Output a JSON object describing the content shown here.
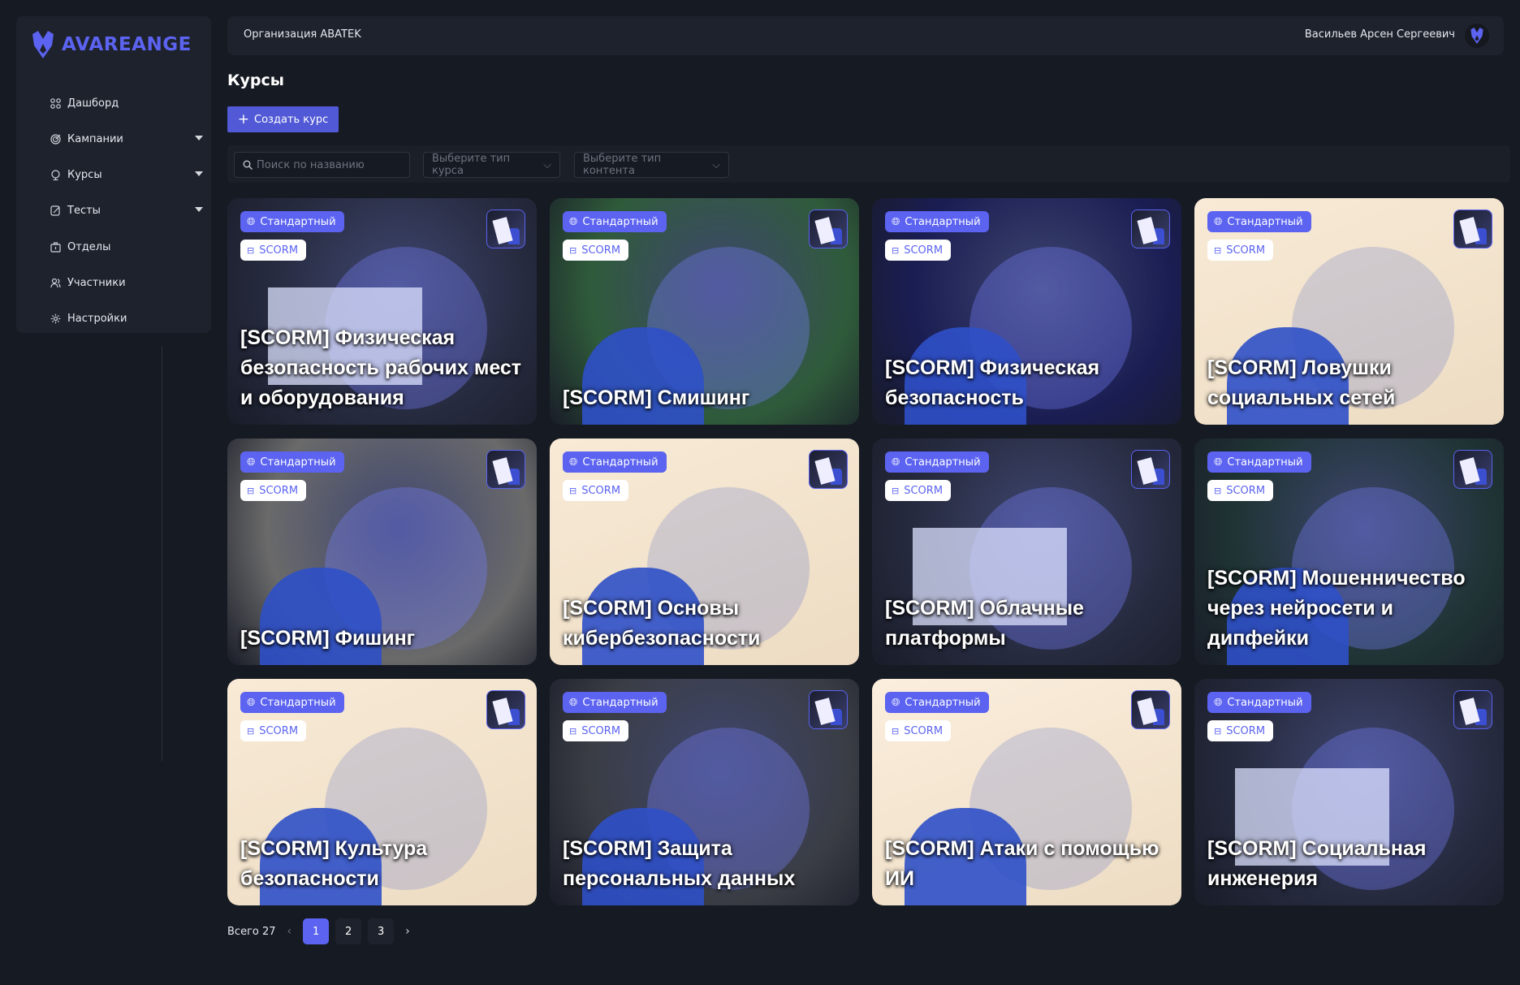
{
  "brand": {
    "name": "AVAREANGE",
    "accent": "#5b63f0"
  },
  "sidebar": {
    "items": [
      {
        "label": "Дашборд",
        "icon": "dashboard-icon",
        "has_submenu": false
      },
      {
        "label": "Кампании",
        "icon": "target-icon",
        "has_submenu": true
      },
      {
        "label": "Курсы",
        "icon": "course-icon",
        "has_submenu": true
      },
      {
        "label": "Тесты",
        "icon": "test-icon",
        "has_submenu": true
      },
      {
        "label": "Отделы",
        "icon": "department-icon",
        "has_submenu": false
      },
      {
        "label": "Участники",
        "icon": "users-icon",
        "has_submenu": false
      },
      {
        "label": "Настройки",
        "icon": "settings-icon",
        "has_submenu": false
      }
    ]
  },
  "header": {
    "organization": "Организация ABATEK",
    "user_name": "Васильев Арсен Сергеевич"
  },
  "page": {
    "title": "Курсы",
    "create_button": "Создать курс"
  },
  "filters": {
    "search_placeholder": "Поиск по названию",
    "course_type_placeholder": "Выберите тип курса",
    "content_type_placeholder": "Выберите тип контента"
  },
  "courses": [
    {
      "title": "[SCORM] Физическая безопасность рабочих мест и оборудования",
      "type": "Стандартный",
      "format": "SCORM",
      "bg": "#262a3e"
    },
    {
      "title": "[SCORM] Смишинг",
      "type": "Стандартный",
      "format": "SCORM",
      "bg": "#2f5b3a"
    },
    {
      "title": "[SCORM] Физическая безопасность",
      "type": "Стандартный",
      "format": "SCORM",
      "bg": "#1a1d52"
    },
    {
      "title": "[SCORM] Ловушки социальных сетей",
      "type": "Стандартный",
      "format": "SCORM",
      "bg": "#f8ead6"
    },
    {
      "title": "[SCORM] Фишинг",
      "type": "Стандартный",
      "format": "SCORM",
      "bg": "#6a6a6a"
    },
    {
      "title": "[SCORM] Основы кибербезопасности",
      "type": "Стандартный",
      "format": "SCORM",
      "bg": "#f8ead6"
    },
    {
      "title": "[SCORM] Облачные платформы",
      "type": "Стандартный",
      "format": "SCORM",
      "bg": "#262a3e"
    },
    {
      "title": "[SCORM] Мошенничество через нейросети и дипфейки",
      "type": "Стандартный",
      "format": "SCORM",
      "bg": "#1f3434"
    },
    {
      "title": "[SCORM] Культура безопасности",
      "type": "Стандартный",
      "format": "SCORM",
      "bg": "#f8ead6"
    },
    {
      "title": "[SCORM] Защита персональных данных",
      "type": "Стандартный",
      "format": "SCORM",
      "bg": "#3a3d44"
    },
    {
      "title": "[SCORM] Атаки с помощью ИИ",
      "type": "Стандартный",
      "format": "SCORM",
      "bg": "#fbeedd"
    },
    {
      "title": "[SCORM] Социальная инженерия",
      "type": "Стандартный",
      "format": "SCORM",
      "bg": "#262a3e"
    }
  ],
  "pagination": {
    "total_label": "Всего 27",
    "pages": [
      "1",
      "2",
      "3"
    ],
    "current": "1"
  }
}
